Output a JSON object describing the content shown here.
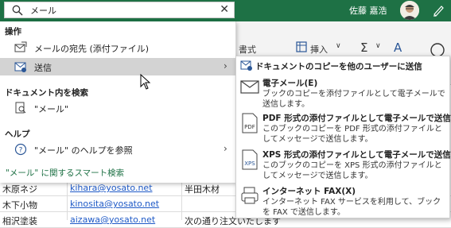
{
  "titlebar": {
    "search_value": "メール",
    "username": "佐藤 嘉浩",
    "clear_glyph": "✕",
    "bg_color": "#1e7145"
  },
  "ribbon": {
    "format_label": "書式",
    "insert_label": "挿入",
    "sum_glyph": "Σ"
  },
  "dropdown": {
    "section_operations": "操作",
    "items_operations": [
      {
        "label": "メールの宛先 (添付ファイル)",
        "icon": "mail-recipient-icon"
      },
      {
        "label": "送信",
        "icon": "send-icon",
        "has_submenu": true
      }
    ],
    "section_search_doc": "ドキュメント内を検索",
    "search_doc_item": "\"メール\"",
    "section_help": "ヘルプ",
    "help_item": "\"メール\" のヘルプを参照",
    "smart_search": "\"メール\" に関するスマート検索"
  },
  "submenu": {
    "header": "ドキュメントのコピーを他のユーザーに送信",
    "items": [
      {
        "title": "電子メール(E)",
        "desc": "ブックのコピーを添付ファイルとして電子メールで送信します。",
        "icon": "email-icon"
      },
      {
        "title": "PDF 形式の添付ファイルとして電子メールで送信(P)",
        "desc": "このブックのコピーを PDF 形式の添付ファイルとしてメッセージで送信します。",
        "icon": "pdf-icon"
      },
      {
        "title": "XPS 形式の添付ファイルとして電子メールで送信(S)",
        "desc": "このブックのコピーを XPS 形式の添付ファイルとしてメッセージで送信します。",
        "icon": "xps-icon"
      },
      {
        "title": "インターネット FAX(X)",
        "desc": "インターネット FAX サービスを利用して、ブックを FAX で送信します。",
        "icon": "fax-icon"
      }
    ]
  },
  "sheet": {
    "rows": [
      {
        "name": "木原ネジ",
        "email": "kihara@yosato.net",
        "col3": "半田木材"
      },
      {
        "name": "木下小物",
        "email": "kinosita@yosato.net",
        "col3": ""
      },
      {
        "name": "相沢塗装",
        "email": "aizawa@yosato.net",
        "col3": "次の通り注文いたします"
      }
    ]
  }
}
